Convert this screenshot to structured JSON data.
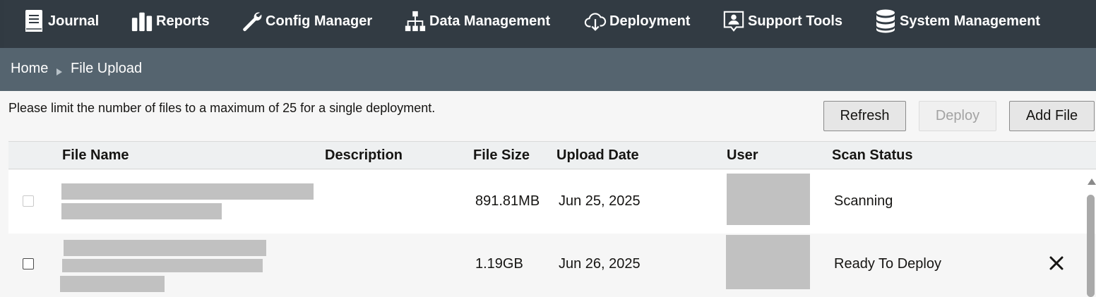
{
  "nav": {
    "items": [
      {
        "label": "Journal",
        "icon": "journal-icon"
      },
      {
        "label": "Reports",
        "icon": "bar-chart-icon"
      },
      {
        "label": "Config Manager",
        "icon": "wrench-icon"
      },
      {
        "label": "Data Management",
        "icon": "hierarchy-icon"
      },
      {
        "label": "Deployment",
        "icon": "cloud-download-icon"
      },
      {
        "label": "Support Tools",
        "icon": "support-user-icon"
      },
      {
        "label": "System Management",
        "icon": "database-icon"
      }
    ]
  },
  "breadcrumb": {
    "home": "Home",
    "separator_icon": "triangle-right-icon",
    "current": "File Upload"
  },
  "notice": "Please limit the number of files to a maximum of 25 for a single deployment.",
  "buttons": {
    "refresh": "Refresh",
    "deploy": "Deploy",
    "add_file": "Add File"
  },
  "table": {
    "columns": [
      "File Name",
      "Description",
      "File Size",
      "Upload Date",
      "User",
      "Scan Status"
    ],
    "rows": [
      {
        "file_size": "891.81MB",
        "upload_date": "Jun 25, 2025",
        "scan_status": "Scanning",
        "checkbox_enabled": false
      },
      {
        "file_size": "1.19GB",
        "upload_date": "Jun 26, 2025",
        "scan_status": "Ready To Deploy",
        "checkbox_enabled": true,
        "remove_icon": "close-icon"
      }
    ]
  },
  "colors": {
    "nav_bg": "#323b43",
    "breadcrumb_bg": "#55646f",
    "page_bg": "#f6f6f6",
    "redaction": "#c1c1c1"
  }
}
